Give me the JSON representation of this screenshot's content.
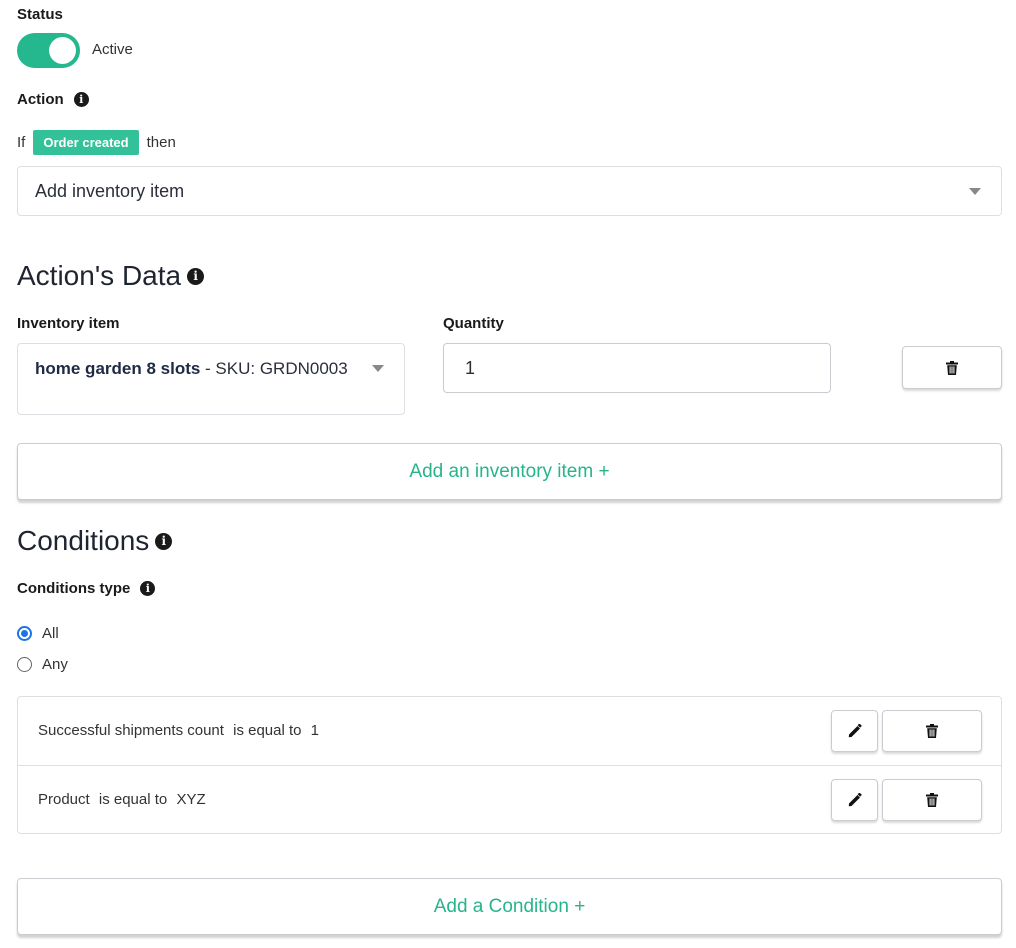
{
  "status": {
    "label": "Status",
    "toggle_text": "Active",
    "active": true
  },
  "action": {
    "label": "Action",
    "if_word": "If",
    "trigger_badge": "Order created",
    "then_word": "then",
    "selected": "Add inventory item"
  },
  "actions_data": {
    "title": "Action's Data",
    "inventory_label": "Inventory item",
    "quantity_label": "Quantity",
    "item_name": "home garden 8 slots",
    "item_sku_text": " - SKU: GRDN0003",
    "quantity_value": "1",
    "add_button": "Add an inventory item +"
  },
  "conditions": {
    "title": "Conditions",
    "type_label": "Conditions type",
    "options": [
      {
        "label": "All",
        "checked": true
      },
      {
        "label": "Any",
        "checked": false
      }
    ],
    "rows": [
      {
        "field": "Successful shipments count",
        "operator": "is equal to",
        "value": "1"
      },
      {
        "field": "Product",
        "operator": "is equal to",
        "value": "XYZ"
      }
    ],
    "add_button": "Add a Condition +"
  },
  "colors": {
    "accent": "#25b78d",
    "badge": "#33c19a",
    "radio": "#1a73e8"
  },
  "icons": {
    "info": "info-icon",
    "trash": "trash-icon",
    "edit": "pencil-icon",
    "dropdown": "caret-down-icon"
  }
}
